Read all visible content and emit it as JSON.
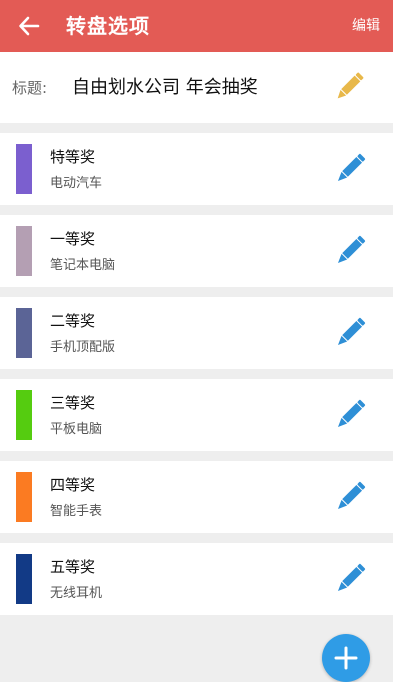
{
  "header": {
    "title": "转盘选项",
    "edit_label": "编辑",
    "back_icon": "arrow-left-icon"
  },
  "title_row": {
    "label": "标题:",
    "value": "自由划水公司 年会抽奖",
    "edit_icon": "pencil-icon",
    "edit_icon_color": "#e8b84a"
  },
  "prizes": [
    {
      "name": "特等奖",
      "item": "电动汽车",
      "color": "#7b5fcf"
    },
    {
      "name": "一等奖",
      "item": "笔记本电脑",
      "color": "#b49fb3"
    },
    {
      "name": "二等奖",
      "item": "手机顶配版",
      "color": "#5b6496"
    },
    {
      "name": "三等奖",
      "item": "平板电脑",
      "color": "#55cc10"
    },
    {
      "name": "四等奖",
      "item": "智能手表",
      "color": "#fb7b22"
    },
    {
      "name": "五等奖",
      "item": "无线耳机",
      "color": "#123a86"
    }
  ],
  "colors": {
    "header_bg": "#e35b55",
    "prize_edit_icon": "#2e8fd6",
    "fab": "#2f9ce6"
  },
  "fab_icon": "add-icon"
}
